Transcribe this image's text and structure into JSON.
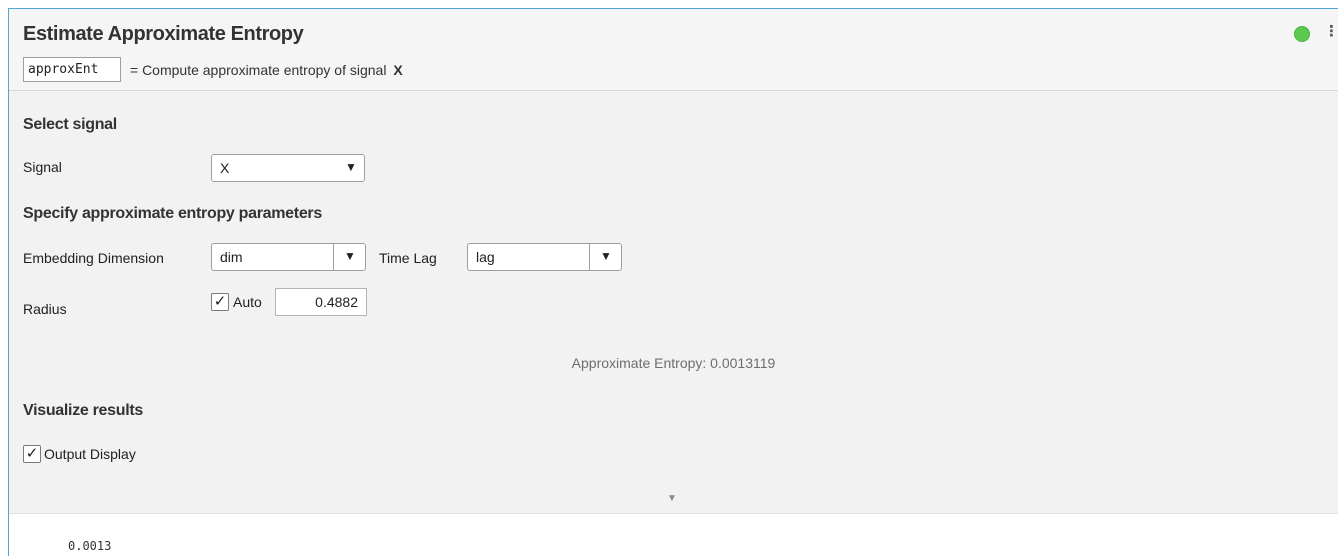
{
  "header": {
    "title": "Estimate Approximate Entropy",
    "output_variable": "approxEnt",
    "summary_prefix": "= Compute approximate entropy of signal",
    "summary_signal": "X",
    "status_color": "#5bc94f",
    "menu_glyph": "⋮"
  },
  "select_signal": {
    "section_title": "Select signal",
    "signal_label": "Signal",
    "signal_value": "X"
  },
  "parameters": {
    "section_title": "Specify approximate entropy parameters",
    "embedding_label": "Embedding Dimension",
    "embedding_value": "dim",
    "timelag_label": "Time Lag",
    "timelag_value": "lag",
    "radius_label": "Radius",
    "auto_label": "Auto",
    "auto_checked": true,
    "radius_value": "0.4882"
  },
  "result": {
    "text": "Approximate Entropy: 0.0013119"
  },
  "visualize": {
    "section_title": "Visualize results",
    "output_display_label": "Output Display",
    "output_display_checked": true
  },
  "output": {
    "value": "0.0013"
  },
  "icons": {
    "dropdown_arrow": "▼",
    "checkmark": "✓",
    "collapse_arrow": "▼"
  }
}
